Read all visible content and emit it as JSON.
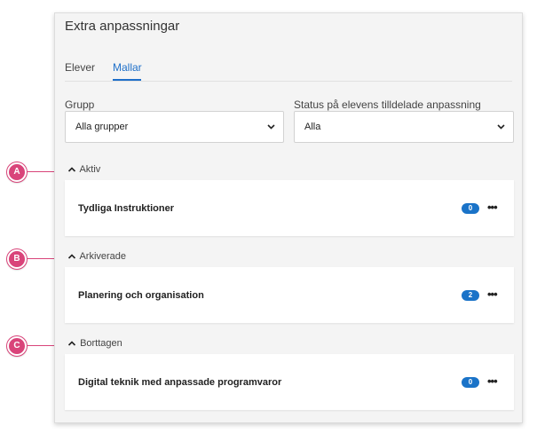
{
  "window": {
    "title": "Extra anpassningar"
  },
  "tabs": [
    {
      "label": "Elever",
      "active": false
    },
    {
      "label": "Mallar",
      "active": true
    }
  ],
  "filters": {
    "group": {
      "label": "Grupp",
      "value": "Alla grupper"
    },
    "status": {
      "label": "Status på elevens tilldelade anpassning",
      "value": "Alla"
    }
  },
  "sections": [
    {
      "marker": "A",
      "label": "Aktiv",
      "expanded": true,
      "items": [
        {
          "name": "Tydliga Instruktioner",
          "count": "0"
        }
      ]
    },
    {
      "marker": "B",
      "label": "Arkiverade",
      "expanded": true,
      "items": [
        {
          "name": "Planering och organisation",
          "count": "2"
        }
      ]
    },
    {
      "marker": "C",
      "label": "Borttagen",
      "expanded": true,
      "items": [
        {
          "name": "Digital teknik med anpassade programvaror",
          "count": "0"
        }
      ]
    }
  ],
  "colors": {
    "accent": "#1e6fc9",
    "badge": "#1a73c8",
    "marker": "#d9447a"
  },
  "icons": {
    "more": "more-horizontal-icon",
    "caret": "chevron-up-icon",
    "select": "chevron-down-icon"
  }
}
